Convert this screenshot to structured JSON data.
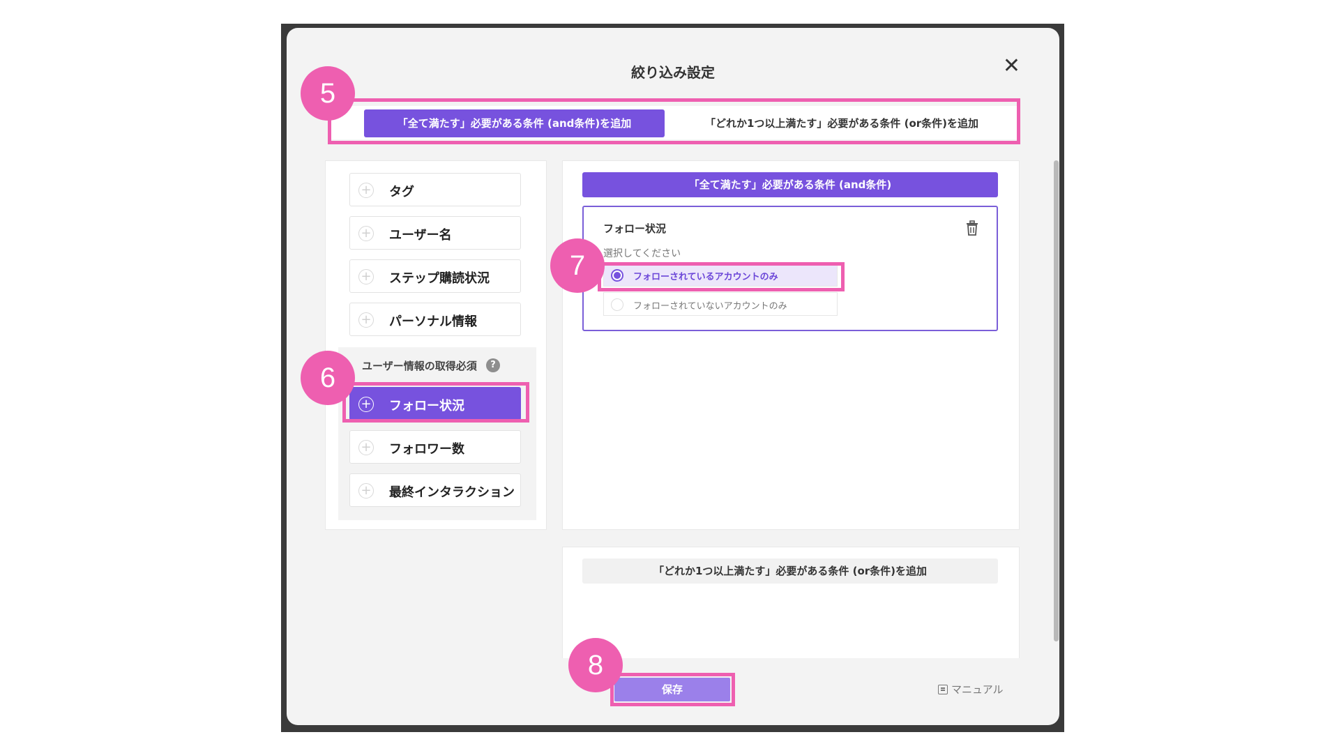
{
  "dialog": {
    "title": "絞り込み設定",
    "close": "✕"
  },
  "tabs": {
    "and": "「全て満たす」必要がある条件 (and条件)を追加",
    "or": "「どれか1つ以上満たす」必要がある条件 (or条件)を追加"
  },
  "left_panel": {
    "items": [
      "タグ",
      "ユーザー名",
      "ステップ購読状況",
      "パーソナル情報"
    ],
    "group_heading": "ユーザー情報の取得必須",
    "help": "?",
    "group_items": [
      "フォロー状況",
      "フォロワー数",
      "最終インタラクション"
    ],
    "active_item": "フォロー状況"
  },
  "right_panel": {
    "and_header": "「全て満たす」必要がある条件 (and条件)",
    "condition": {
      "title": "フォロー状況",
      "prompt": "選択してください",
      "options": [
        "フォローされているアカウントのみ",
        "フォローされていないアカウントのみ"
      ],
      "selected": "フォローされているアカウントのみ"
    },
    "or_header": "「どれか1つ以上満たす」必要がある条件 (or条件)を追加"
  },
  "footer": {
    "save": "保存",
    "manual": "マニュアル"
  },
  "annotations": {
    "step5": "5",
    "step6": "6",
    "step7": "7",
    "step8": "8"
  },
  "colors": {
    "accent": "#7752de",
    "highlight": "#ee5fb0",
    "save_button": "#9b80ea"
  },
  "icons": [
    "close-icon",
    "plus-circle-icon",
    "help-icon",
    "trash-icon",
    "radio-icon",
    "book-icon"
  ]
}
